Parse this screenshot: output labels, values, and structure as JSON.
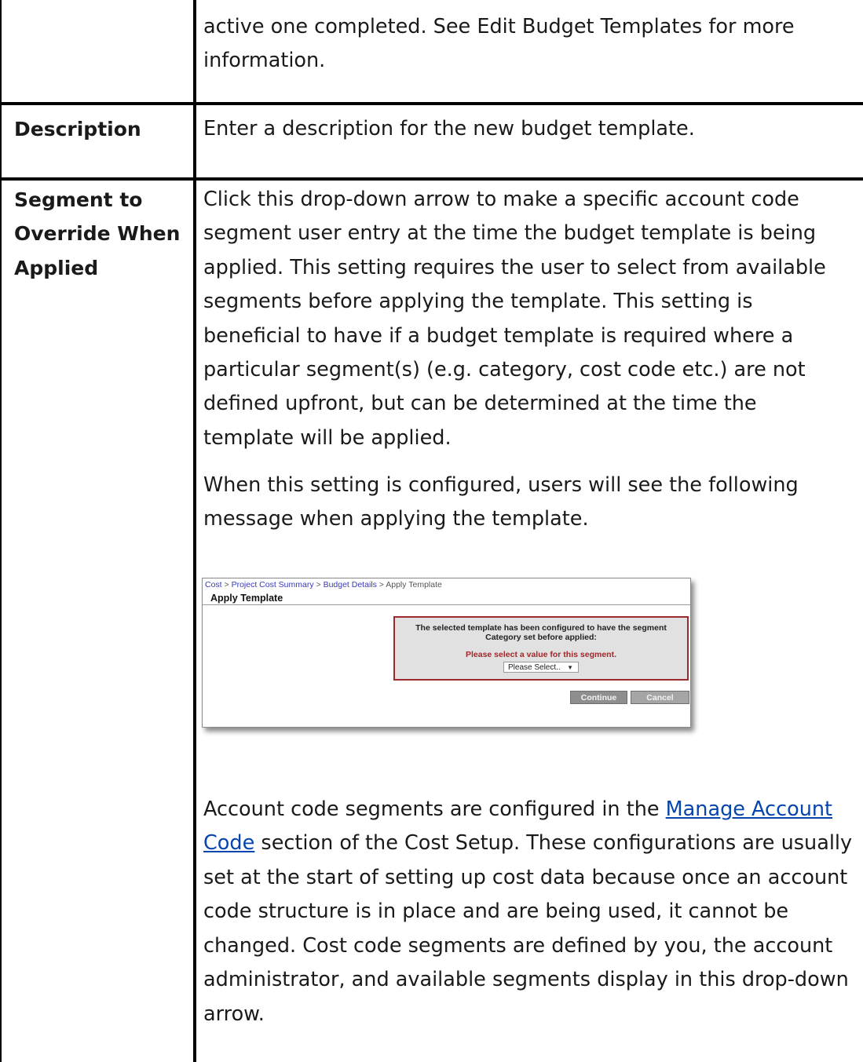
{
  "row_top": {
    "text_line1": "active one completed. See Edit Budget Templates for more",
    "text_line2": "information."
  },
  "row_description": {
    "label": "Description",
    "text": "Enter a description for the new budget template."
  },
  "row_segment": {
    "label_lines": [
      "Segment to",
      "Override When",
      "Applied"
    ],
    "para1_lines": [
      "Click this drop-down arrow to make a specific account code",
      "segment user entry at the time the budget template is being",
      "applied. This setting requires the user to select from available",
      "segments before applying the template. This setting is",
      "beneficial to have if a budget template is required where a",
      "particular segment(s) (e.g. category, cost code etc.) are not",
      "defined upfront, but can be determined at the time the",
      "template will be applied."
    ],
    "para2_lines": [
      "When this setting is configured, users will see the following",
      "message when applying the template."
    ],
    "para3": {
      "line1_before": "Account code segments are configured in the ",
      "line1_link": "Manage Account",
      "line2_link": "Code",
      "line2_after": " section of the Cost Setup. These configurations are usually",
      "rest_lines": [
        "set at the start of setting up cost data because once an account",
        "code structure is in place and are being used, it cannot be",
        "changed. Cost code segments are defined by you, the account",
        "administrator, and available segments display in this drop-down",
        "arrow."
      ]
    }
  },
  "screenshot": {
    "breadcrumb": {
      "items": [
        "Cost",
        "Project Cost Summary",
        "Budget Details"
      ],
      "current": "Apply Template",
      "separator": " > "
    },
    "title": "Apply Template",
    "message_line1": "The selected template has been configured to have the segment",
    "message_line2": "Category set before applied:",
    "warning": "Please select a value for this segment.",
    "select_value": "Please Select..",
    "continue_label": "Continue",
    "cancel_label": "Cancel"
  },
  "colors": {
    "link": "#0645ad",
    "warning": "#a3272a",
    "box_border": "#9b2a2a"
  }
}
